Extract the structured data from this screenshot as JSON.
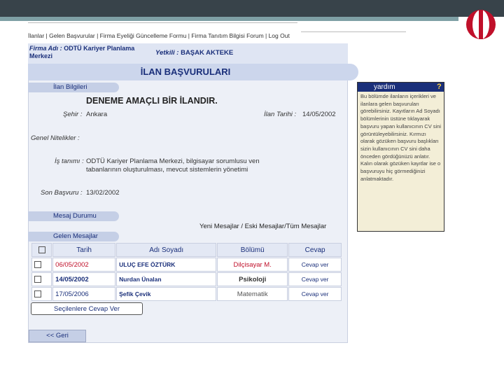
{
  "nav": "İlanlar | Gelen Başvurular | Firma Eyeliği Güncelleme Formu | Firma Tanıtım Bilgisi Forum | Log Out",
  "firma": {
    "label": "Firma Adı :",
    "name": "ODTÜ Kariyer Planlama Merkezi"
  },
  "yetkili": {
    "label": "Yetkili :",
    "name": "BAŞAK AKTEKE"
  },
  "page_title": "İLAN BAŞVURULARI",
  "sections": {
    "ilan": "İlan Bilgileri",
    "mesaj": "Mesaj Durumu",
    "gelen": "Gelen Mesajlar"
  },
  "ilan": {
    "title": "DENEME AMAÇLI BİR İLANDIR.",
    "sehir_label": "Şehir :",
    "sehir": "Ankara",
    "tarih_label": "İlan Tarihi :",
    "tarih": "14/05/2002",
    "genel_label": "Genel Nitelikler :",
    "is_label": "İş tanımı :",
    "is_tanimi": "ODTÜ Kariyer Planlama Merkezi, bilgisayar sorumlusu ven tabanlarının oluşturulması, mevcut sistemlerin yönetimi",
    "son_label": "Son Başvuru :",
    "son_basvuru": "13/02/2002"
  },
  "mesaj_links": "Yeni Mesajlar / Eski Mesajlar/Tüm Mesajlar",
  "table": {
    "headers": [
      "Tarih",
      "Adı Soyadı",
      "Bölümü",
      "Cevap"
    ],
    "rows": [
      {
        "tarih": "06/05/2002",
        "ad": "ULUÇ EFE ÖZTÜRK",
        "bolum": "Dilçisayar M.",
        "cevap": "Cevap ver"
      },
      {
        "tarih": "14/05/2002",
        "ad": "Nurdan Ünalan",
        "bolum": "Psikoloji",
        "cevap": "Cevap ver"
      },
      {
        "tarih": "17/05/2006",
        "ad": "Şefik Çevik",
        "bolum": "Matematik",
        "cevap": "Cevap ver"
      }
    ]
  },
  "buttons": {
    "secilen": "Seçilenlere Cevap Ver",
    "geri": "<< Geri"
  },
  "help": {
    "title": "yardım",
    "q": "?",
    "text": "Bu bölümde ilanların içerikleri ve ilanlara gelen başvuruları görebilirsiniz. Kayıtların Ad Soyadı bölümlerinin üstüne tıklayarak başvuru yapan kullanıcının CV sini görüntüleyebilirsiniz. Kırmızı olarak gözüken başvuru başlıkları sizin kullanıcının CV sini daha önceden gördüğünüzü anlatır. Kalın olarak gözüken kayıtlar ise o başvuruyu hiç görmediğinizi anlatmaktadır."
  },
  "colors": {
    "accent": "#1a2f7a",
    "panel": "#edf0f7",
    "pill": "#c5cfe6",
    "help_bg": "#f3eed7",
    "red": "#c0102a"
  }
}
